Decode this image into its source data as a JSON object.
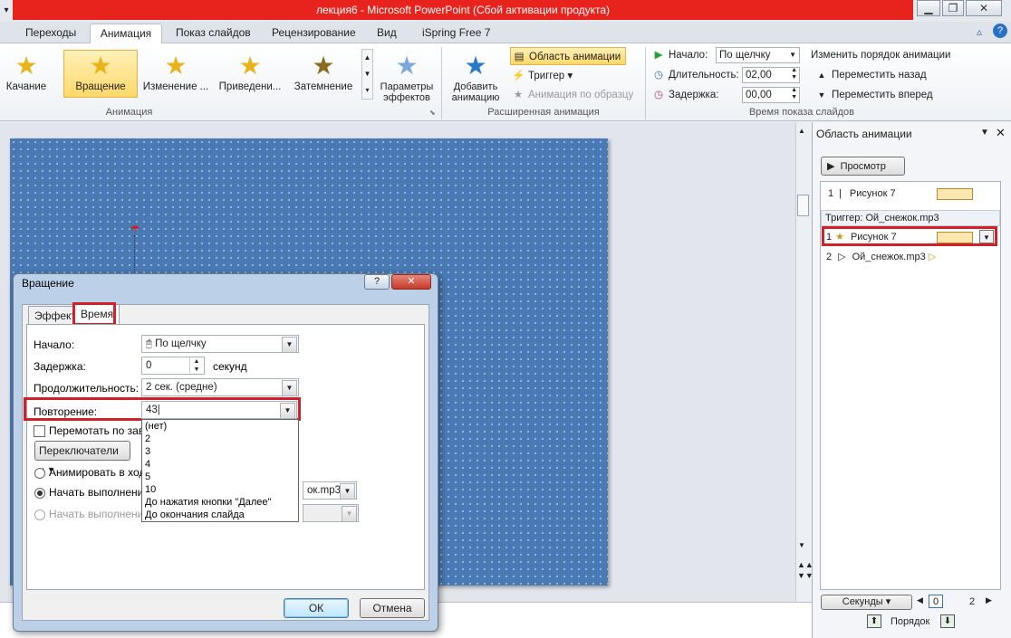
{
  "window": {
    "title": "лекция6 - Microsoft PowerPoint (Сбой активации продукта)",
    "min_icon": "minimize-icon",
    "max_icon": "restore-icon",
    "close_icon": "close-icon"
  },
  "tabs": [
    "Переходы",
    "Анимация",
    "Показ слайдов",
    "Рецензирование",
    "Вид",
    "iSpring Free 7"
  ],
  "active_tab": "Анимация",
  "ribbon": {
    "animations": [
      "Качание",
      "Вращение",
      "Изменение ...",
      "Приведени...",
      "Затемнение"
    ],
    "selected_animation": "Вращение",
    "effects_button": "Параметры эффектов",
    "group_animation": "Анимация",
    "add_animation": "Добавить анимацию",
    "area_animation": "Область анимации",
    "trigger": "Триггер",
    "by_sample": "Анимация по образцу",
    "group_advanced": "Расширенная анимация",
    "start_label": "Начало:",
    "start_value": "По щелчку",
    "duration_label": "Длительность:",
    "duration_value": "02,00",
    "delay_label": "Задержка:",
    "delay_value": "00,00",
    "group_timing": "Время показа слайдов",
    "reorder_title": "Изменить порядок анимации",
    "move_back": "Переместить назад",
    "move_forward": "Переместить вперед"
  },
  "anim_pane": {
    "title": "Область анимации",
    "preview": "Просмотр",
    "item1_num": "1",
    "item1_name": "Рисунок 7",
    "trigger_label": "Триггер: Ой_снежок.mp3",
    "item2_num": "1",
    "item2_name": "Рисунок 7",
    "item3_num": "2",
    "item3_name": "Ой_снежок.mp3",
    "seconds": "Секунды",
    "timeline_0": "0",
    "timeline_2": "2",
    "order": "Порядок"
  },
  "dialog": {
    "title": "Вращение",
    "help": "?",
    "tab_effect": "Эффект",
    "tab_time": "Время",
    "start_label": "Начало:",
    "start_value": "По щелчку",
    "delay_label": "Задержка:",
    "delay_value": "0",
    "delay_unit": "секунд",
    "duration_label": "Продолжительность:",
    "duration_value": "2 сек. (средне)",
    "repeat_label": "Повторение:",
    "repeat_value": "43",
    "rewind_label": "Перемотать по заве",
    "switches_button": "Переключатели",
    "radio1": "Анимировать в ходе",
    "radio2": "Начать выполнение",
    "radio2_value": "ок.mp3",
    "radio3": "Начать выполнение",
    "ok": "ОК",
    "cancel": "Отмена",
    "dropdown_options": [
      "(нет)",
      "2",
      "3",
      "4",
      "5",
      "10",
      "До нажатия кнопки \"Далее\"",
      "До окончания слайда"
    ]
  },
  "colors": {
    "title_bar": "#e8231e",
    "slide": "#4a7ab5",
    "highlight": "#d0202a"
  }
}
